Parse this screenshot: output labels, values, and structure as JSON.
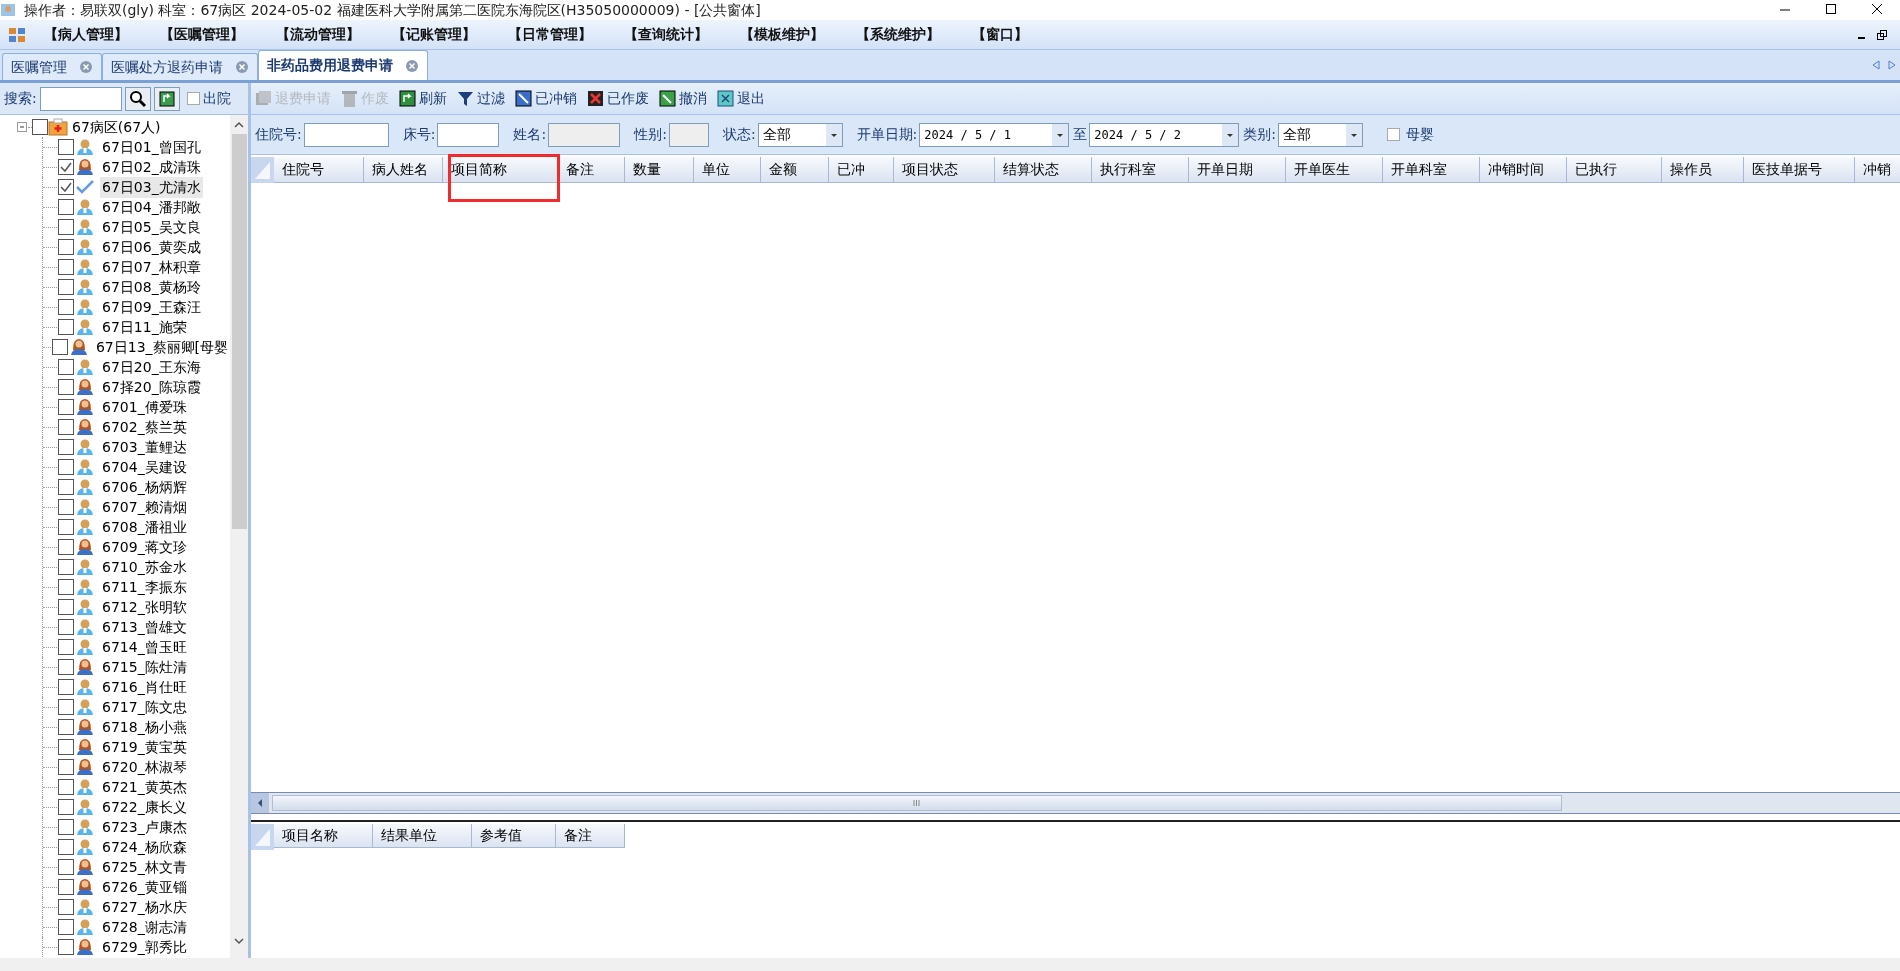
{
  "window": {
    "title": "操作者：易联双(gly)  科室：67病区  2024-05-02  福建医科大学附属第二医院东海院区(H35050000009) - [公共窗体]"
  },
  "menu": [
    "【病人管理】",
    "【医嘱管理】",
    "【流动管理】",
    "【记账管理】",
    "【日常管理】",
    "【查询统计】",
    "【模板维护】",
    "【系统维护】",
    "【窗口】"
  ],
  "tabs": [
    {
      "label": "医嘱管理",
      "selected": false
    },
    {
      "label": "医嘱处方退药申请",
      "selected": false
    },
    {
      "label": "非药品费用退费申请",
      "selected": true
    }
  ],
  "left_panel": {
    "search_label": "搜索:",
    "discharged": {
      "label": "出院",
      "checked": false
    },
    "tree": {
      "label": "67病区(67人)",
      "expanded": true,
      "checked": false,
      "children": [
        {
          "label": "67日01_曾国孔",
          "kind": "male",
          "checked": false,
          "selected": false
        },
        {
          "label": "67日02_成清珠",
          "kind": "female",
          "checked": true,
          "selected": false
        },
        {
          "label": "67日03_尤清水",
          "kind": "confirmed",
          "checked": true,
          "selected": true
        },
        {
          "label": "67日04_潘邦敞",
          "kind": "male",
          "checked": false,
          "selected": false
        },
        {
          "label": "67日05_吴文良",
          "kind": "male",
          "checked": false,
          "selected": false
        },
        {
          "label": "67日06_黄奕成",
          "kind": "male",
          "checked": false,
          "selected": false
        },
        {
          "label": "67日07_林积章",
          "kind": "male",
          "checked": false,
          "selected": false
        },
        {
          "label": "67日08_黄杨玲",
          "kind": "male",
          "checked": false,
          "selected": false
        },
        {
          "label": "67日09_王森汪",
          "kind": "male",
          "checked": false,
          "selected": false
        },
        {
          "label": "67日11_施荣",
          "kind": "male",
          "checked": false,
          "selected": false
        },
        {
          "label": "67日13_蔡丽卿[母婴",
          "kind": "female",
          "checked": false,
          "selected": false
        },
        {
          "label": "67日20_王东海",
          "kind": "male",
          "checked": false,
          "selected": false
        },
        {
          "label": "67择20_陈琼霞",
          "kind": "female",
          "checked": false,
          "selected": false
        },
        {
          "label": "6701_傅爱珠",
          "kind": "female",
          "checked": false,
          "selected": false
        },
        {
          "label": "6702_蔡兰英",
          "kind": "female",
          "checked": false,
          "selected": false
        },
        {
          "label": "6703_董鲤达",
          "kind": "male",
          "checked": false,
          "selected": false
        },
        {
          "label": "6704_吴建设",
          "kind": "male",
          "checked": false,
          "selected": false
        },
        {
          "label": "6706_杨炳辉",
          "kind": "male",
          "checked": false,
          "selected": false
        },
        {
          "label": "6707_赖清烟",
          "kind": "male",
          "checked": false,
          "selected": false
        },
        {
          "label": "6708_潘祖业",
          "kind": "male",
          "checked": false,
          "selected": false
        },
        {
          "label": "6709_蒋文珍",
          "kind": "female",
          "checked": false,
          "selected": false
        },
        {
          "label": "6710_苏金水",
          "kind": "male",
          "checked": false,
          "selected": false
        },
        {
          "label": "6711_李振东",
          "kind": "male",
          "checked": false,
          "selected": false
        },
        {
          "label": "6712_张明软",
          "kind": "male",
          "checked": false,
          "selected": false
        },
        {
          "label": "6713_曾雄文",
          "kind": "male",
          "checked": false,
          "selected": false
        },
        {
          "label": "6714_曾玉旺",
          "kind": "male",
          "checked": false,
          "selected": false
        },
        {
          "label": "6715_陈灶清",
          "kind": "female",
          "checked": false,
          "selected": false
        },
        {
          "label": "6716_肖仕旺",
          "kind": "male",
          "checked": false,
          "selected": false
        },
        {
          "label": "6717_陈文忠",
          "kind": "male",
          "checked": false,
          "selected": false
        },
        {
          "label": "6718_杨小燕",
          "kind": "female",
          "checked": false,
          "selected": false
        },
        {
          "label": "6719_黄宝英",
          "kind": "female",
          "checked": false,
          "selected": false
        },
        {
          "label": "6720_林淑琴",
          "kind": "female",
          "checked": false,
          "selected": false
        },
        {
          "label": "6721_黄英杰",
          "kind": "male",
          "checked": false,
          "selected": false
        },
        {
          "label": "6722_康长义",
          "kind": "male",
          "checked": false,
          "selected": false
        },
        {
          "label": "6723_卢康杰",
          "kind": "male",
          "checked": false,
          "selected": false
        },
        {
          "label": "6724_杨欣森",
          "kind": "male",
          "checked": false,
          "selected": false
        },
        {
          "label": "6725_林文青",
          "kind": "female",
          "checked": false,
          "selected": false
        },
        {
          "label": "6726_黄亚锱",
          "kind": "female",
          "checked": false,
          "selected": false
        },
        {
          "label": "6727_杨水庆",
          "kind": "male",
          "checked": false,
          "selected": false
        },
        {
          "label": "6728_谢志清",
          "kind": "male",
          "checked": false,
          "selected": false
        },
        {
          "label": "6729_郭秀比",
          "kind": "female",
          "checked": false,
          "selected": false
        }
      ]
    }
  },
  "toolbar": [
    {
      "label": "退费申请",
      "kind": "apply",
      "disabled": true
    },
    {
      "label": "作废",
      "kind": "trash",
      "disabled": true
    },
    {
      "label": "刷新",
      "kind": "refresh",
      "disabled": false
    },
    {
      "label": "过滤",
      "kind": "filter",
      "disabled": false
    },
    {
      "label": "已冲销",
      "kind": "reversed",
      "disabled": false
    },
    {
      "label": "已作废",
      "kind": "voided",
      "disabled": false
    },
    {
      "label": "撤消",
      "kind": "undo",
      "disabled": false
    },
    {
      "label": "退出",
      "kind": "exit",
      "disabled": false
    }
  ],
  "filters": [
    {
      "label": "住院号:",
      "kind": "text",
      "disabled": false
    },
    {
      "label": "床号:",
      "kind": "text",
      "disabled": false
    },
    {
      "label": "姓名:",
      "kind": "text",
      "disabled": true
    },
    {
      "label": "性别:",
      "kind": "text",
      "disabled": true
    },
    {
      "label": "状态:",
      "kind": "select",
      "value": "全部"
    },
    {
      "label": "开单日期:",
      "kind": "date",
      "value": "2024 / 5 / 1"
    },
    {
      "label": "至",
      "kind": "date",
      "value": "2024 / 5 / 2"
    },
    {
      "label": "类别:",
      "kind": "select",
      "value": "全部"
    },
    {
      "label": "母婴",
      "kind": "checkbox",
      "checked": false
    }
  ],
  "grid": {
    "columns": [
      "住院号",
      "病人姓名",
      "项目简称",
      "备注",
      "数量",
      "单位",
      "金额",
      "已冲",
      "项目状态",
      "结算状态",
      "执行科室",
      "开单日期",
      "开单医生",
      "开单科室",
      "冲销时间",
      "已执行",
      "操作员",
      "医技单据号",
      "冲销"
    ]
  },
  "detail_grid": {
    "columns": [
      "项目名称",
      "结果单位",
      "参考值",
      "备注"
    ]
  }
}
